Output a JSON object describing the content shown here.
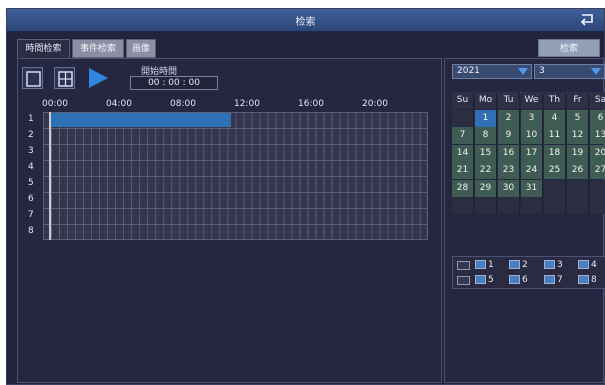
{
  "window": {
    "title": "检索"
  },
  "tabs": [
    {
      "label": "時間检索",
      "active": true
    },
    {
      "label": "事件检索",
      "active": false
    },
    {
      "label": "画像",
      "active": false
    }
  ],
  "search_button": "检索",
  "toolbar": {
    "tools": [
      "single-view-icon",
      "quad-view-icon",
      "play-icon"
    ]
  },
  "start_time": {
    "label": "開始時間",
    "value": "00 : 00 : 00"
  },
  "timeline": {
    "hours": [
      "00:00",
      "04:00",
      "08:00",
      "12:00",
      "16:00",
      "20:00"
    ],
    "channels": [
      "1",
      "2",
      "3",
      "4",
      "5",
      "6",
      "7",
      "8"
    ]
  },
  "calendar": {
    "year": "2021",
    "month": "3",
    "weekdays": [
      "Su",
      "Mo",
      "Tu",
      "We",
      "Th",
      "Fr",
      "Sa"
    ],
    "selected_day": "1",
    "weeks": [
      [
        "",
        "1",
        "2",
        "3",
        "4",
        "5",
        "6"
      ],
      [
        "7",
        "8",
        "9",
        "10",
        "11",
        "12",
        "13"
      ],
      [
        "14",
        "15",
        "16",
        "17",
        "18",
        "19",
        "20"
      ],
      [
        "21",
        "22",
        "23",
        "24",
        "25",
        "26",
        "27"
      ],
      [
        "28",
        "29",
        "30",
        "31",
        "",
        "",
        ""
      ],
      [
        "",
        "",
        "",
        "",
        "",
        "",
        ""
      ]
    ]
  },
  "channel_select": [
    "1",
    "2",
    "3",
    "4",
    "5",
    "6",
    "7",
    "8"
  ],
  "colors": {
    "accent": "#2f70b4",
    "titlebar": "#3f5f99",
    "background": "#23233b",
    "calendar_day": "#3f5c54"
  }
}
